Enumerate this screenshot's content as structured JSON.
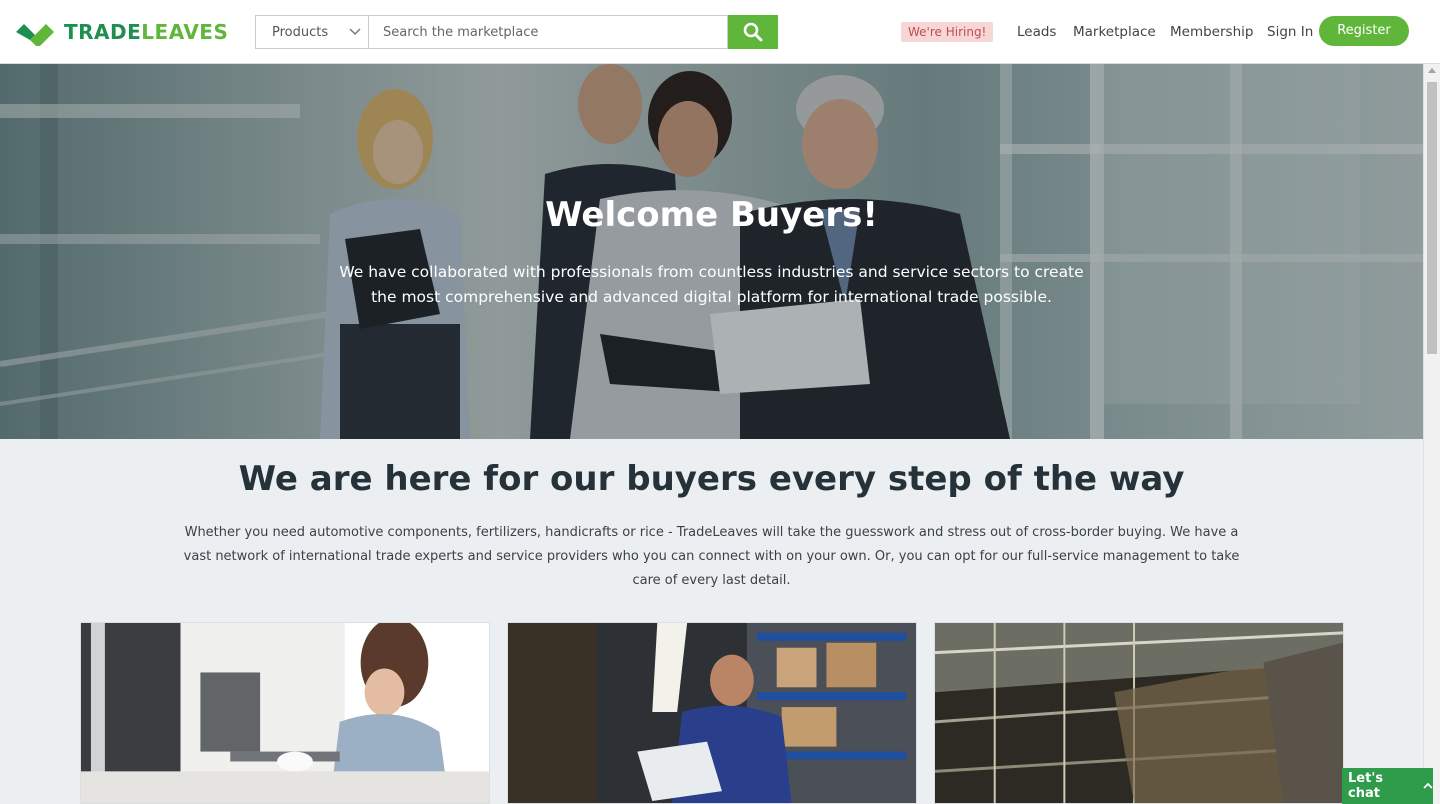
{
  "header": {
    "logo_part1": "TRADE",
    "logo_part2": "LEAVES",
    "category_select": "Products",
    "search_placeholder": "Search the marketplace",
    "hiring_badge": "We're Hiring!",
    "nav": [
      "Leads",
      "Marketplace",
      "Membership",
      "Sign In"
    ],
    "register_label": "Register"
  },
  "hero": {
    "title": "Welcome Buyers!",
    "subtitle": "We have collaborated with professionals from countless industries and service sectors to create the most comprehensive and advanced digital platform for international trade possible."
  },
  "intro": {
    "title": "We are here for our buyers every step of the way",
    "text": "Whether you need automotive components, fertilizers, handicrafts or rice - TradeLeaves will take the guesswork and stress out of cross-border buying. We have a vast network of international trade experts and service providers who you can connect with on your own. Or, you can opt for our full-service management to take care of every last detail."
  },
  "chat": {
    "label": "Let's chat"
  },
  "icons": {
    "logo": "leaf-logo-icon",
    "search": "search-icon",
    "dropdown": "chevron-down-icon",
    "chat": "chevron-up-icon"
  },
  "colors": {
    "brand_green": "#5fb63a",
    "brand_dark_green": "#1e8f4f",
    "hiring_bg": "#f7d6d6",
    "hiring_text": "#c24e4e",
    "page_bg": "#eceff1",
    "heading": "#26323a"
  }
}
